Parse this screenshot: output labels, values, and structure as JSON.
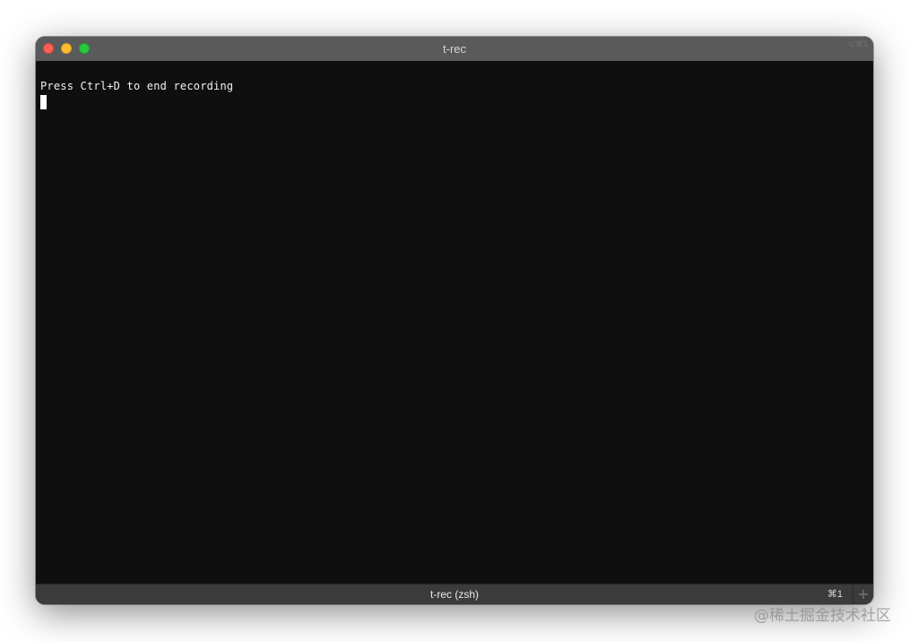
{
  "window": {
    "title": "t-rec",
    "title_right": "⌥⌘1"
  },
  "terminal": {
    "lines": [
      "Press Ctrl+D to end recording"
    ]
  },
  "tabbar": {
    "title": "t-rec (zsh)",
    "shortcut": "⌘1",
    "new_tab": "+"
  },
  "watermark": "@稀土掘金技术社区",
  "colors": {
    "titlebar": "#5a5a5a",
    "terminal_bg": "#0f0f0f",
    "tabbar": "#3b3b3b",
    "close": "#ff5f57",
    "minimize": "#febc2e",
    "maximize": "#28c840"
  }
}
